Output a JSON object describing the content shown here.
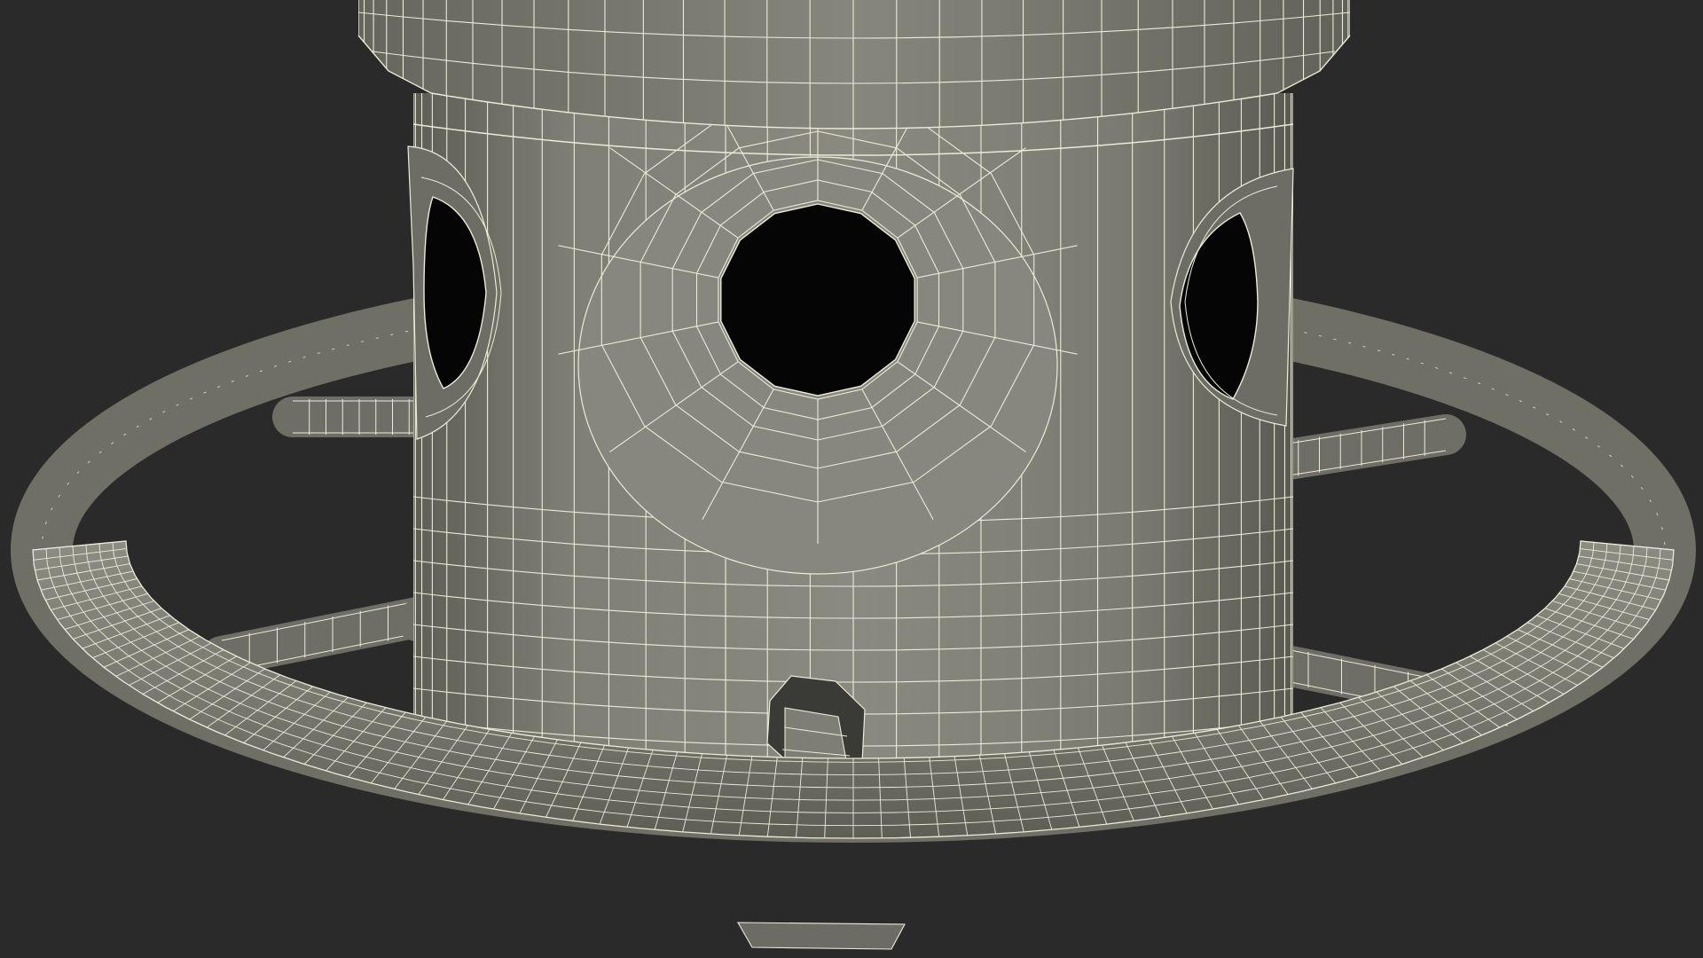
{
  "scene": {
    "subject": "wireframe-bird-feeder-render",
    "colors": {
      "background": "#2a2a2a",
      "surface": "#7b7b72",
      "surface_light": "#8e8e84",
      "surface_dark": "#5a5a52",
      "wire": "#ecebd7",
      "hole": "#050505"
    }
  }
}
